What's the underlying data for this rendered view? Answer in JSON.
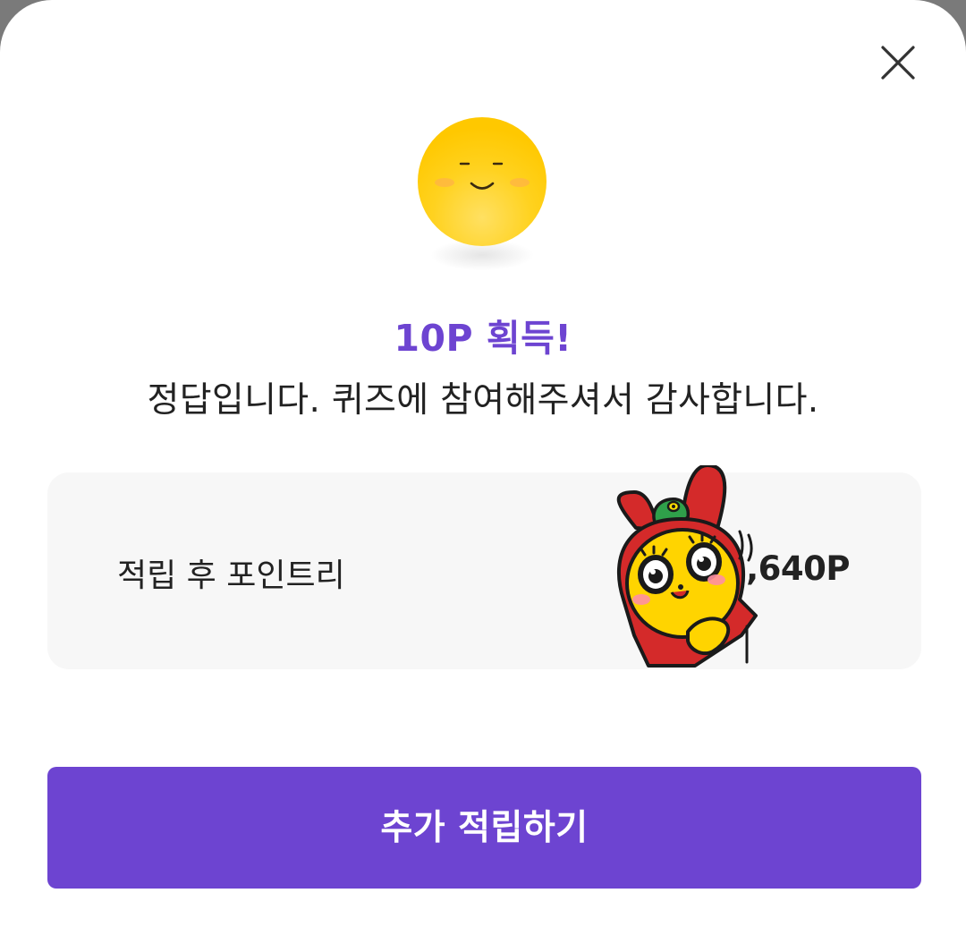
{
  "dialog": {
    "close_icon": "close-icon",
    "emoji_icon": "smiling-face-icon",
    "title": "10P 획득!",
    "message": "정답입니다. 퀴즈에 참여해주셔서 감사합니다.",
    "points_card": {
      "label": "적립 후 포인트리",
      "value": "1,640P",
      "sticker_icon": "character-sticker"
    },
    "cta_label": "추가 적립하기"
  },
  "colors": {
    "accent": "#6d44d1",
    "sheet_background": "#ffffff",
    "card_background": "#f7f7f7",
    "text_primary": "#222222",
    "emoji_yellow": "#ffca0a"
  }
}
